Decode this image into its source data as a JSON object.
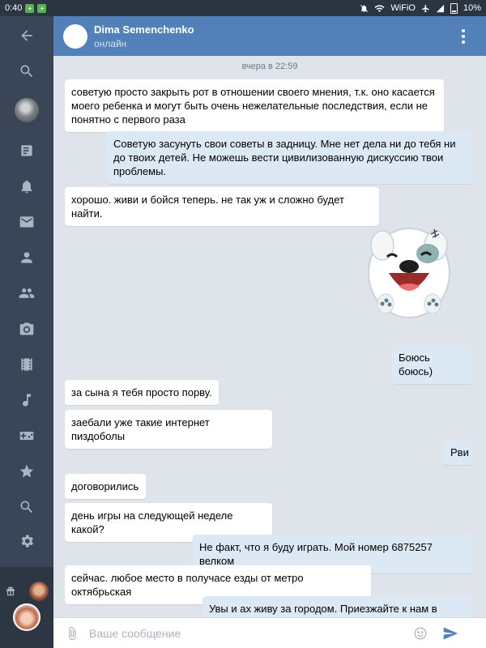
{
  "status_bar": {
    "time": "0:40",
    "network": "WiFiO",
    "battery": "10%"
  },
  "sidebar": {
    "items": [
      {
        "icon": "back-arrow-icon"
      },
      {
        "icon": "search-icon"
      },
      {
        "icon": "profile-avatar"
      },
      {
        "icon": "news-icon"
      },
      {
        "icon": "notifications-bell-icon"
      },
      {
        "icon": "messages-envelope-icon"
      },
      {
        "icon": "friends-person-icon"
      },
      {
        "icon": "groups-people-icon"
      },
      {
        "icon": "photos-camera-icon"
      },
      {
        "icon": "videos-film-icon"
      },
      {
        "icon": "music-note-icon"
      },
      {
        "icon": "games-gamepad-icon"
      },
      {
        "icon": "favorites-star-icon"
      },
      {
        "icon": "search-icon"
      },
      {
        "icon": "settings-gear-icon"
      }
    ]
  },
  "header": {
    "name": "Dima Semenchenko",
    "status": "онлайн",
    "accent": "#5181b8"
  },
  "chat": {
    "date_separator": "вчера в 22:59",
    "messages": [
      {
        "dir": "in",
        "text": "советую просто закрыть рот в отношении своего мнения, т.к. оно касается моего ребенка и могут быть очень нежелательные последствия, если не понятно с первого раза"
      },
      {
        "dir": "out",
        "text": "Советую засунуть свои советы в задницу. Мне нет дела ни до тебя ни до твоих детей. Не можешь вести цивилизованную дискуссию твои проблемы."
      },
      {
        "dir": "in",
        "text": "хорошо. живи и бойся теперь. не так уж и сложно будет найти."
      },
      {
        "dir": "out",
        "type": "sticker",
        "sticker": "white-dog-laughing-sticker"
      },
      {
        "dir": "out",
        "text": "Боюсь боюсь)"
      },
      {
        "dir": "in",
        "text": "за сына я тебя просто порву."
      },
      {
        "dir": "in",
        "text": "заебали уже такие интернет пиздоболы"
      },
      {
        "dir": "out",
        "text": "Рви"
      },
      {
        "dir": "in",
        "text": "договорились"
      },
      {
        "dir": "in",
        "text": "день игры на следующей неделе какой?"
      },
      {
        "dir": "out",
        "text": "Не факт, что я буду играть. Мой номер 6875257 велком"
      },
      {
        "dir": "in",
        "text": "сейчас. любое место в получасе езды от метро октябрьская"
      },
      {
        "dir": "out",
        "text": "Увы и ах живу за городом. Приезжайте к нам в гости)"
      }
    ]
  },
  "input": {
    "placeholder": "Ваше сообщение",
    "value": ""
  }
}
